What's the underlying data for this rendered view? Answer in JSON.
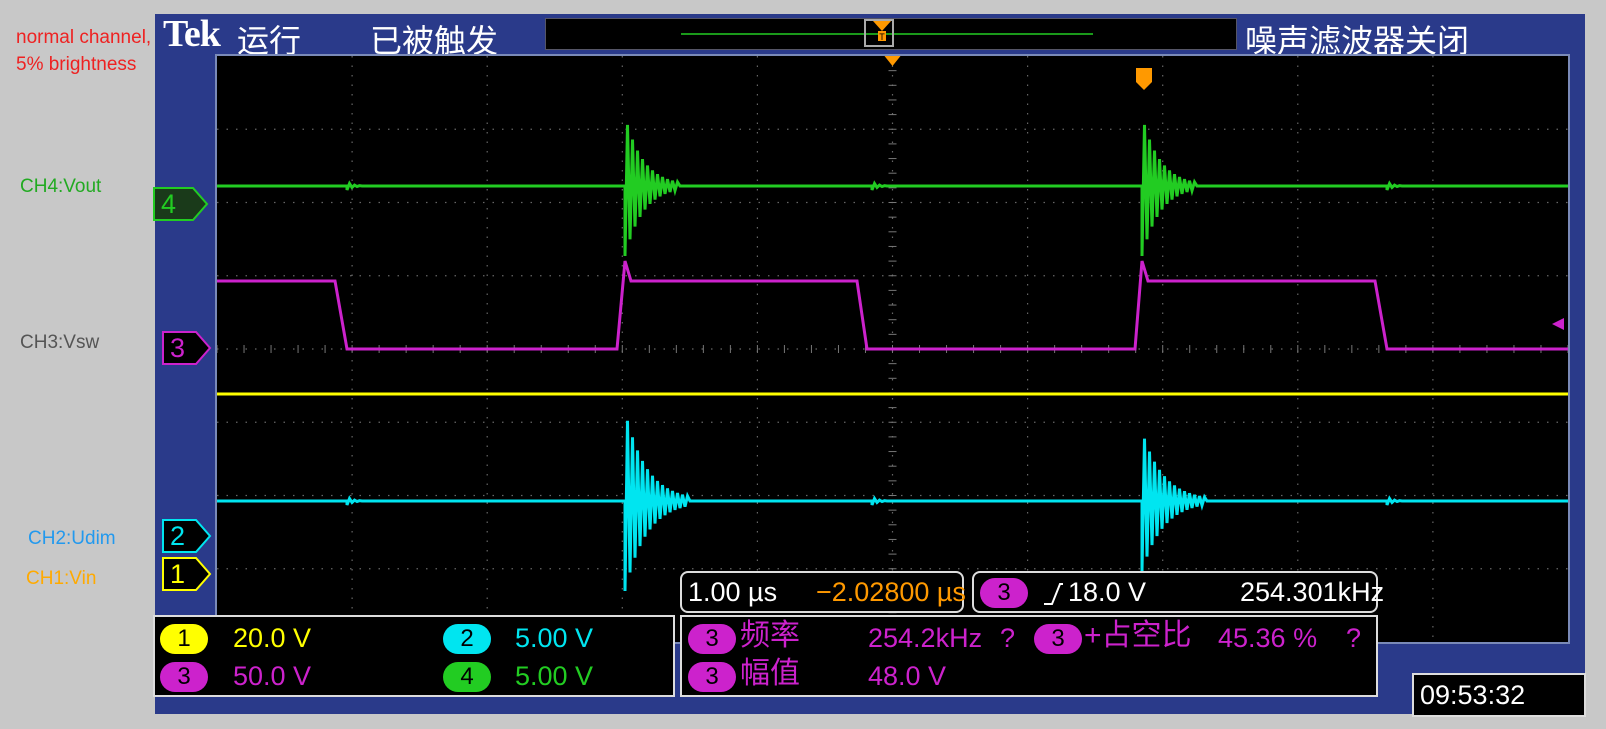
{
  "annotations": {
    "note_line1": "normal channel,",
    "note_line2": "5% brightness",
    "ch4": "CH4:Vout",
    "ch3": "CH3:Vsw",
    "ch2": "CH2:Udim",
    "ch1": "CH1:Vin"
  },
  "topbar": {
    "logo": "Tek",
    "run_state": "运行",
    "trigger_state": "已被触发",
    "noise_filter": "噪声滤波器关闭"
  },
  "channel_markers": {
    "ch4": "4",
    "ch3": "3",
    "ch2": "2",
    "ch1": "1"
  },
  "timebase": {
    "scale": "1.00 µs",
    "position": "−2.02800 µs"
  },
  "trigger_readout": {
    "source": "3",
    "slope_icon": "rising-edge-icon",
    "level": "18.0 V",
    "frequency": "254.301kHz"
  },
  "channel_scales": [
    {
      "ch": "1",
      "scale": "20.0 V",
      "color": "#ffff00"
    },
    {
      "ch": "2",
      "scale": "5.00 V",
      "color": "#00e5f0"
    },
    {
      "ch": "3",
      "scale": "50.0 V",
      "color": "#cc22cc"
    },
    {
      "ch": "4",
      "scale": "5.00 V",
      "color": "#22cc22"
    }
  ],
  "measurements": [
    {
      "ch": "3",
      "name": "频率",
      "value": "254.2kHz",
      "flag": "?"
    },
    {
      "ch": "3",
      "name": "+占空比",
      "value": "45.36 %",
      "flag": "?"
    },
    {
      "ch": "3",
      "name": "幅值",
      "value": "48.0 V",
      "flag": ""
    }
  ],
  "clock": "09:53:32",
  "colors": {
    "ch1": "#ffff00",
    "ch2": "#00e5f0",
    "ch3": "#cc22cc",
    "ch4": "#22cc22",
    "trigger": "#ff9900",
    "frame": "#2a3a8a"
  }
}
